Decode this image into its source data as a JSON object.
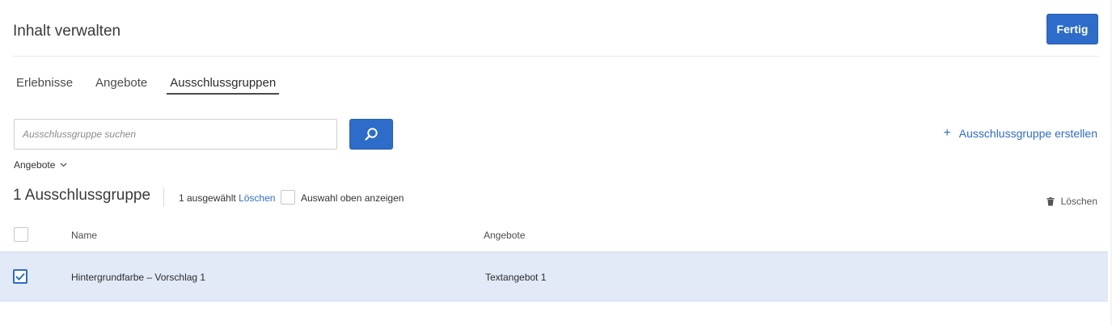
{
  "header": {
    "title": "Inhalt verwalten",
    "done_label": "Fertig"
  },
  "tabs": [
    {
      "label": "Erlebnisse",
      "active": false
    },
    {
      "label": "Angebote",
      "active": false
    },
    {
      "label": "Ausschlussgruppen",
      "active": true
    }
  ],
  "search": {
    "placeholder": "Ausschlussgruppe suchen",
    "value": ""
  },
  "create_label": "Ausschlussgruppe erstellen",
  "filter": {
    "label": "Angebote"
  },
  "list": {
    "count_label": "1 Ausschlussgruppe",
    "selected_text": "1 ausgewählt",
    "delete_link": "Löschen",
    "show_selected_label": "Auswahl oben anzeigen",
    "delete_label": "Löschen",
    "columns": {
      "name": "Name",
      "offers": "Angebote"
    },
    "rows": [
      {
        "name": "Hintergrundfarbe – Vorschlag 1",
        "offers": "Textangebot 1",
        "checked": true
      }
    ]
  },
  "colors": {
    "accent": "#2d6cc9",
    "selected_row": "#e2eaf7"
  },
  "icons": {
    "search": "search-icon",
    "add": "plus-icon",
    "delete": "trash-icon",
    "filter": "chevron-down-icon",
    "check": "check-icon"
  }
}
